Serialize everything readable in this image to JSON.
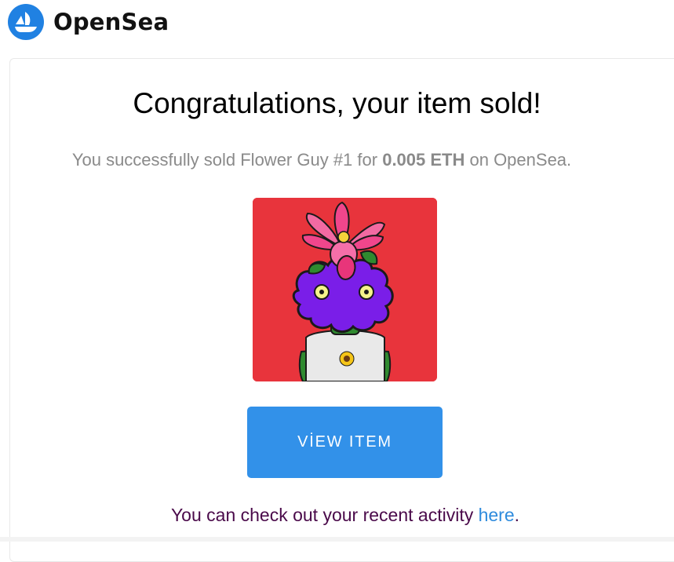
{
  "header": {
    "brand": "OpenSea",
    "logo_icon": "opensea-boat-icon",
    "brand_color": "#2081e2"
  },
  "main": {
    "title": "Congratulations, your item sold!",
    "subtitle_before": "You successfully sold Flower Guy #1 for ",
    "price": "0.005 ETH",
    "subtitle_after": " on OpenSea.",
    "nft": {
      "icon": "flower-guy-nft-image",
      "background_color": "#e8343c"
    },
    "view_button_label": "VİEW ITEM",
    "view_button_color": "#3291e9",
    "activity_before": "You can check out your recent activity ",
    "activity_link": "here",
    "activity_after": "."
  }
}
